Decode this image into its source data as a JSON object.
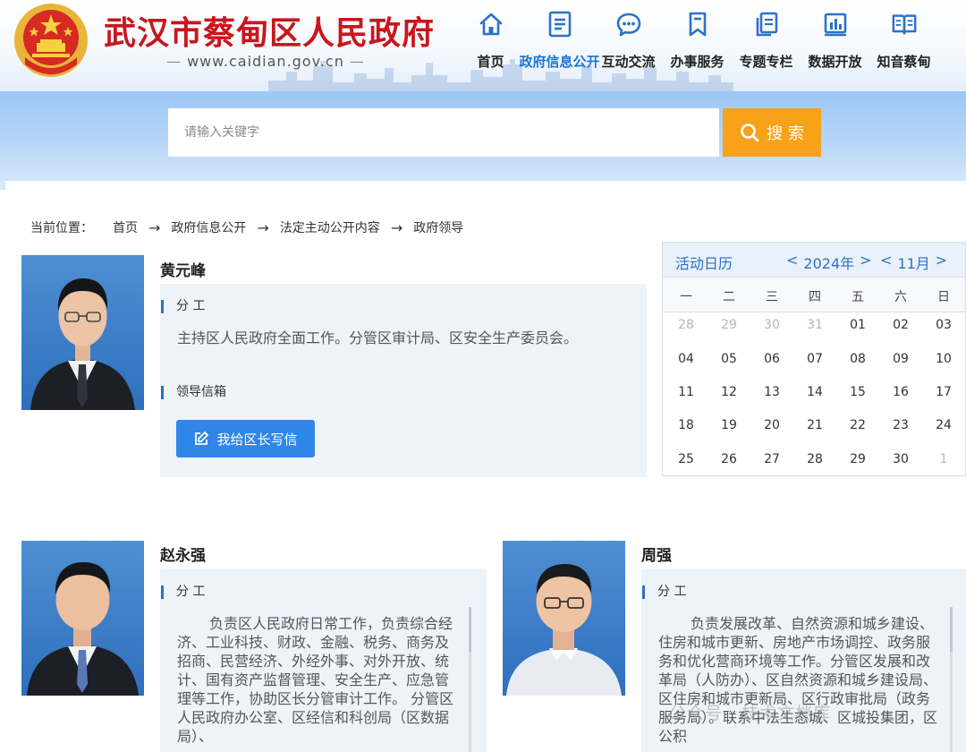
{
  "site": {
    "title": "武汉市蔡甸区人民政府",
    "domain": "www.caidian.gov.cn"
  },
  "nav": [
    {
      "label": "首页",
      "icon": "home-icon"
    },
    {
      "label": "政府信息公开",
      "icon": "document-list-icon",
      "active": true
    },
    {
      "label": "互动交流",
      "icon": "chat-bubble-icon"
    },
    {
      "label": "办事服务",
      "icon": "bookmark-icon"
    },
    {
      "label": "专题专栏",
      "icon": "copy-document-icon"
    },
    {
      "label": "数据开放",
      "icon": "bar-chart-icon"
    },
    {
      "label": "知音蔡甸",
      "icon": "open-book-icon"
    }
  ],
  "search": {
    "placeholder": "请输入关键字",
    "button_label": "搜 索"
  },
  "breadcrumb": {
    "label": "当前位置：",
    "items": [
      "首页",
      "政府信息公开",
      "法定主动公开内容",
      "政府领导"
    ],
    "separator": "→"
  },
  "leaders": [
    {
      "name": "黄元峰",
      "duty_title": "分 工",
      "duty_text": "主持区人民政府全面工作。分管区审计局、区安全生产委员会。",
      "mailbox_title": "领导信箱",
      "mailbox_button": "我给区长写信"
    },
    {
      "name": "赵永强",
      "duty_title": "分 工",
      "duty_text": "负责区人民政府日常工作，负责综合经济、工业科技、财政、金融、税务、商务及招商、民营经济、外经外事、对外开放、统计、国有资产监督管理、安全生产、应急管理等工作，协助区长分管审计工作。 分管区人民政府办公室、区经信和科创局（区数据局）、"
    },
    {
      "name": "周强",
      "duty_title": "分 工",
      "duty_text": "负责发展改革、自然资源和城乡建设、住房和城市更新、房地产市场调控、政务服务和优化营商环境等工作。分管区发展和改革局（人防办）、区自然资源和城乡建设局、区住房和城市更新局、区行政审批局（政务服务局）。联系中法生态城、区城投集团，区公积"
    }
  ],
  "calendar": {
    "title": "活动日历",
    "year": "2024年",
    "month": "11月",
    "prev": "<",
    "next": ">",
    "weekdays": [
      "一",
      "二",
      "三",
      "四",
      "五",
      "六",
      "日"
    ],
    "weeks": [
      [
        {
          "d": "28",
          "m": true
        },
        {
          "d": "29",
          "m": true
        },
        {
          "d": "30",
          "m": true
        },
        {
          "d": "31",
          "m": true
        },
        {
          "d": "01"
        },
        {
          "d": "02"
        },
        {
          "d": "03"
        }
      ],
      [
        {
          "d": "04"
        },
        {
          "d": "05"
        },
        {
          "d": "06"
        },
        {
          "d": "07"
        },
        {
          "d": "08"
        },
        {
          "d": "09"
        },
        {
          "d": "10"
        }
      ],
      [
        {
          "d": "11"
        },
        {
          "d": "12"
        },
        {
          "d": "13"
        },
        {
          "d": "14"
        },
        {
          "d": "15"
        },
        {
          "d": "16"
        },
        {
          "d": "17"
        }
      ],
      [
        {
          "d": "18"
        },
        {
          "d": "19"
        },
        {
          "d": "20"
        },
        {
          "d": "21"
        },
        {
          "d": "22"
        },
        {
          "d": "23"
        },
        {
          "d": "24"
        }
      ],
      [
        {
          "d": "25"
        },
        {
          "d": "26"
        },
        {
          "d": "27"
        },
        {
          "d": "28"
        },
        {
          "d": "29"
        },
        {
          "d": "30"
        },
        {
          "d": "1",
          "m": true
        }
      ]
    ]
  },
  "watermark": "公众号 · 技术文档库",
  "colors": {
    "brand_red": "#c9161d",
    "link_blue": "#1a75d8",
    "search_orange": "#f8a219",
    "button_blue": "#2f86e8"
  }
}
